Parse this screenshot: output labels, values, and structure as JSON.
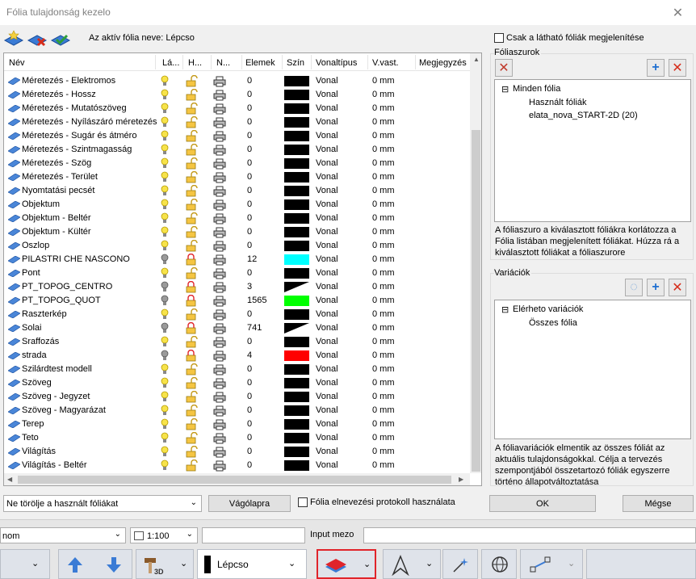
{
  "window": {
    "title": "Fólia tulajdonság kezelo",
    "close_glyph": "✕"
  },
  "toolbar": {
    "active_label": "Az aktív fólia neve: Lépcso"
  },
  "only_visible_label": "Csak a látható fóliák megjelenítése",
  "columns": [
    "Név",
    "Lá...",
    "H...",
    "N...",
    "Elemek",
    "Szín",
    "Vonaltípus",
    "V.vast.",
    "Megjegyzés"
  ],
  "rows": [
    {
      "name": "Méretezés - Elektromos",
      "visible": true,
      "locked": false,
      "count": "0",
      "color": "#000000",
      "linetype": "Vonal",
      "width": "0 mm"
    },
    {
      "name": "Méretezés - Hossz",
      "visible": true,
      "locked": false,
      "count": "0",
      "color": "#000000",
      "linetype": "Vonal",
      "width": "0 mm"
    },
    {
      "name": "Méretezés - Mutatószöveg",
      "visible": true,
      "locked": false,
      "count": "0",
      "color": "#000000",
      "linetype": "Vonal",
      "width": "0 mm"
    },
    {
      "name": "Méretezés - Nyílászáró méretezés",
      "visible": true,
      "locked": false,
      "count": "0",
      "color": "#000000",
      "linetype": "Vonal",
      "width": "0 mm"
    },
    {
      "name": "Méretezés - Sugár és átméro",
      "visible": true,
      "locked": false,
      "count": "0",
      "color": "#000000",
      "linetype": "Vonal",
      "width": "0 mm"
    },
    {
      "name": "Méretezés - Szintmagasság",
      "visible": true,
      "locked": false,
      "count": "0",
      "color": "#000000",
      "linetype": "Vonal",
      "width": "0 mm"
    },
    {
      "name": "Méretezés - Szög",
      "visible": true,
      "locked": false,
      "count": "0",
      "color": "#000000",
      "linetype": "Vonal",
      "width": "0 mm"
    },
    {
      "name": "Méretezés - Terület",
      "visible": true,
      "locked": false,
      "count": "0",
      "color": "#000000",
      "linetype": "Vonal",
      "width": "0 mm"
    },
    {
      "name": "Nyomtatási pecsét",
      "visible": true,
      "locked": false,
      "count": "0",
      "color": "#000000",
      "linetype": "Vonal",
      "width": "0 mm"
    },
    {
      "name": "Objektum",
      "visible": true,
      "locked": false,
      "count": "0",
      "color": "#000000",
      "linetype": "Vonal",
      "width": "0 mm"
    },
    {
      "name": "Objektum - Beltér",
      "visible": true,
      "locked": false,
      "count": "0",
      "color": "#000000",
      "linetype": "Vonal",
      "width": "0 mm"
    },
    {
      "name": "Objektum - Kültér",
      "visible": true,
      "locked": false,
      "count": "0",
      "color": "#000000",
      "linetype": "Vonal",
      "width": "0 mm"
    },
    {
      "name": "Oszlop",
      "visible": true,
      "locked": false,
      "count": "0",
      "color": "#000000",
      "linetype": "Vonal",
      "width": "0 mm"
    },
    {
      "name": "PILASTRI CHE NASCONO",
      "visible": false,
      "locked": true,
      "count": "12",
      "color": "#00ffff",
      "linetype": "Vonal",
      "width": "0 mm"
    },
    {
      "name": "Pont",
      "visible": true,
      "locked": false,
      "count": "0",
      "color": "#000000",
      "linetype": "Vonal",
      "width": "0 mm"
    },
    {
      "name": "PT_TOPOG_CENTRO",
      "visible": false,
      "locked": true,
      "count": "3",
      "color": "split",
      "linetype": "Vonal",
      "width": "0 mm"
    },
    {
      "name": "PT_TOPOG_QUOT",
      "visible": false,
      "locked": true,
      "count": "1565",
      "color": "#00ff00",
      "linetype": "Vonal",
      "width": "0 mm"
    },
    {
      "name": "Raszterkép",
      "visible": true,
      "locked": false,
      "count": "0",
      "color": "#000000",
      "linetype": "Vonal",
      "width": "0 mm"
    },
    {
      "name": "Solai",
      "visible": false,
      "locked": true,
      "count": "741",
      "color": "split",
      "linetype": "Vonal",
      "width": "0 mm"
    },
    {
      "name": "Sraffozás",
      "visible": true,
      "locked": false,
      "count": "0",
      "color": "#000000",
      "linetype": "Vonal",
      "width": "0 mm"
    },
    {
      "name": "strada",
      "visible": false,
      "locked": true,
      "count": "4",
      "color": "#ff0000",
      "linetype": "Vonal",
      "width": "0 mm"
    },
    {
      "name": "Szilárdtest modell",
      "visible": true,
      "locked": false,
      "count": "0",
      "color": "#000000",
      "linetype": "Vonal",
      "width": "0 mm"
    },
    {
      "name": "Szöveg",
      "visible": true,
      "locked": false,
      "count": "0",
      "color": "#000000",
      "linetype": "Vonal",
      "width": "0 mm"
    },
    {
      "name": "Szöveg - Jegyzet",
      "visible": true,
      "locked": false,
      "count": "0",
      "color": "#000000",
      "linetype": "Vonal",
      "width": "0 mm"
    },
    {
      "name": "Szöveg - Magyarázat",
      "visible": true,
      "locked": false,
      "count": "0",
      "color": "#000000",
      "linetype": "Vonal",
      "width": "0 mm"
    },
    {
      "name": "Terep",
      "visible": true,
      "locked": false,
      "count": "0",
      "color": "#000000",
      "linetype": "Vonal",
      "width": "0 mm"
    },
    {
      "name": "Teto",
      "visible": true,
      "locked": false,
      "count": "0",
      "color": "#000000",
      "linetype": "Vonal",
      "width": "0 mm"
    },
    {
      "name": "Világítás",
      "visible": true,
      "locked": false,
      "count": "0",
      "color": "#000000",
      "linetype": "Vonal",
      "width": "0 mm"
    },
    {
      "name": "Világítás - Beltér",
      "visible": true,
      "locked": false,
      "count": "0",
      "color": "#000000",
      "linetype": "Vonal",
      "width": "0 mm"
    }
  ],
  "filters": {
    "title": "Fóliaszurok",
    "tree": [
      "Minden fólia",
      "Használt fóliák",
      "elata_nova_START-2D (20)"
    ],
    "description": "A fóliaszuro a kiválasztott fóliákra korlátozza a Fólia listában megjelenített fóliákat. Húzza rá a kiválasztott fóliákat a fóliaszurore"
  },
  "variations": {
    "title": "Variációk",
    "tree": [
      "Elérheto variációk",
      "Összes fólia"
    ],
    "description": "A fóliavariációk elmentik az összes fóliát az aktuális tulajdonságokkal. Célja a tervezés szempontjából összetartozó fóliák egyszerre történo állapotváltoztatása"
  },
  "footer": {
    "delete_option": "Ne törölje a használt fóliákat",
    "clipboard_button": "Vágólapra",
    "protocol_label": "Fólia elnevezési protokoll használata",
    "ok_button": "OK",
    "cancel_button": "Mégse"
  },
  "bottom": {
    "left_combo": "nom",
    "scale": "1:100",
    "input_label": "Input mezo",
    "layer_name": "Lépcso"
  }
}
